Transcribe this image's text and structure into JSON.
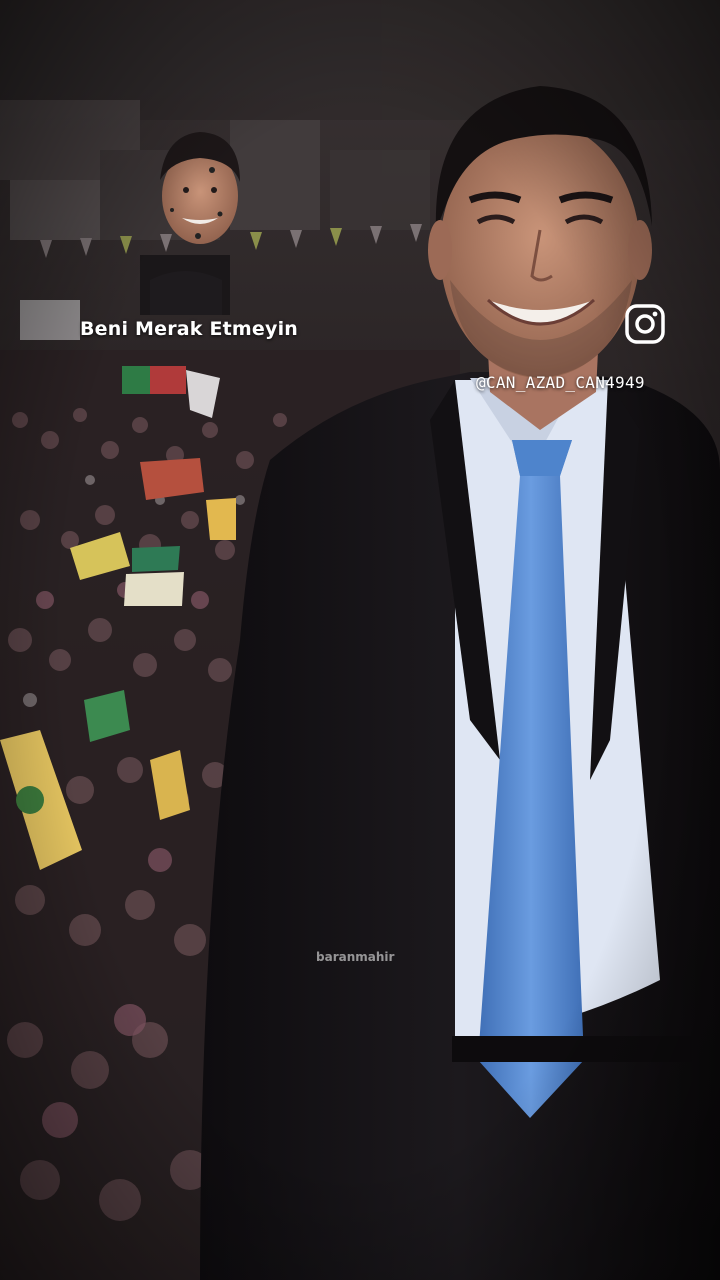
{
  "overlay": {
    "caption": "Beni Merak Etmeyin",
    "instagram_handle": "@CAN_AZAD_CAN4949",
    "watermark": "baranmahir"
  },
  "icons": {
    "social": "instagram-icon"
  },
  "colors": {
    "tie": "#5b8fd6",
    "suit": "#141215",
    "shirt": "#dfe6f3",
    "background": "#2a2426",
    "text": "#ffffff"
  }
}
